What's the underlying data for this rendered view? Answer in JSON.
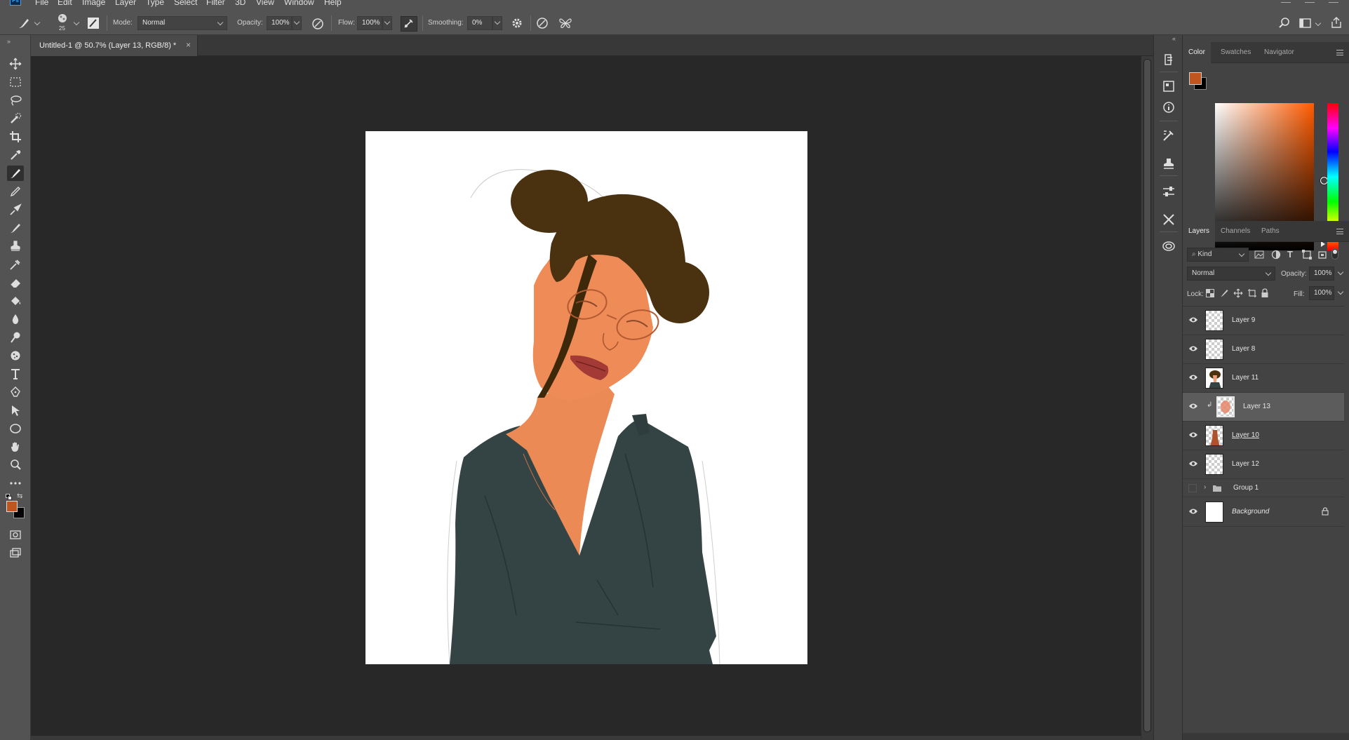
{
  "menubar": {
    "items": [
      "File",
      "Edit",
      "Image",
      "Layer",
      "Type",
      "Select",
      "Filter",
      "3D",
      "View",
      "Window",
      "Help"
    ]
  },
  "options": {
    "brush_size": "25",
    "mode_label": "Mode:",
    "mode_value": "Normal",
    "opacity_label": "Opacity:",
    "opacity_value": "100%",
    "flow_label": "Flow:",
    "flow_value": "100%",
    "smoothing_label": "Smoothing:",
    "smoothing_value": "0%"
  },
  "document": {
    "tab_title": "Untitled-1 @ 50.7% (Layer 13, RGB/8) *",
    "close": "×"
  },
  "color_panel": {
    "tabs": [
      "Color",
      "Swatches",
      "Navigator"
    ],
    "foreground": "#c0551f",
    "background": "#000000"
  },
  "layers_panel": {
    "tabs": [
      "Layers",
      "Channels",
      "Paths"
    ],
    "filter_value": "Kind",
    "blend_mode": "Normal",
    "opacity_label": "Opacity:",
    "opacity_value": "100%",
    "lock_label": "Lock:",
    "fill_label": "Fill:",
    "fill_value": "100%",
    "layers": [
      {
        "name": "Layer 9"
      },
      {
        "name": "Layer 8"
      },
      {
        "name": "Layer 11"
      },
      {
        "name": "Layer 13"
      },
      {
        "name": "Layer 10"
      },
      {
        "name": "Layer 12"
      },
      {
        "name": "Group 1"
      },
      {
        "name": "Background"
      }
    ]
  },
  "toolbar": {
    "foreground": "#c0551f",
    "background": "#000000"
  }
}
